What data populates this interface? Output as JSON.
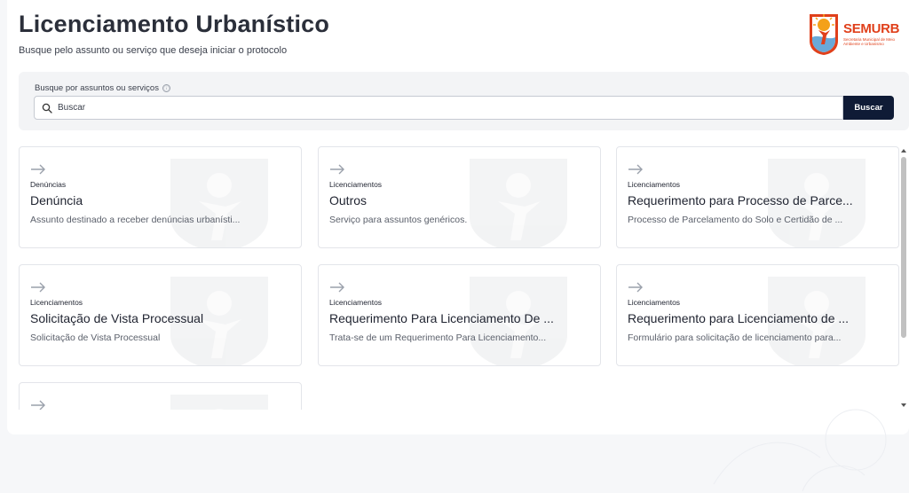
{
  "header": {
    "title": "Licenciamento Urbanístico",
    "subtitle": "Busque pelo assunto ou serviço que deseja iniciar o protocolo"
  },
  "logo": {
    "name": "SEMURB",
    "subtitle": "Secretaria Municipal de Meio Ambiente e Urbanismo",
    "colors": {
      "orange": "#e0401b",
      "sun": "#f4a11a",
      "blue": "#6aa9d8"
    }
  },
  "search": {
    "label": "Busque por assuntos ou serviços",
    "info_icon": "ⓘ",
    "placeholder": "Buscar",
    "value": "",
    "button_label": "Buscar"
  },
  "cards": [
    {
      "category": "Denúncias",
      "title": "Denúncia",
      "description": "Assunto destinado a receber denúncias urbanísti..."
    },
    {
      "category": "Licenciamentos",
      "title": "Outros",
      "description": "Serviço para assuntos genéricos."
    },
    {
      "category": "Licenciamentos",
      "title": "Requerimento para Processo de Parce...",
      "description": "Processo de Parcelamento do Solo e Certidão de ..."
    },
    {
      "category": "Licenciamentos",
      "title": "Solicitação de Vista Processual",
      "description": "Solicitação de Vista Processual"
    },
    {
      "category": "Licenciamentos",
      "title": "Requerimento Para Licenciamento De ...",
      "description": "Trata-se de um Requerimento Para Licenciamento..."
    },
    {
      "category": "Licenciamentos",
      "title": "Requerimento para Licenciamento de ...",
      "description": "Formulário para solicitação de licenciamento para..."
    },
    {
      "category": "",
      "title": "",
      "description": ""
    }
  ],
  "colors": {
    "button": "#0f1b36",
    "search_panel": "#f3f4f6",
    "card_border": "#e3e5ea"
  },
  "icons": {
    "card_arrow": "arrow-right-icon",
    "search": "search-icon",
    "info": "info-icon"
  }
}
